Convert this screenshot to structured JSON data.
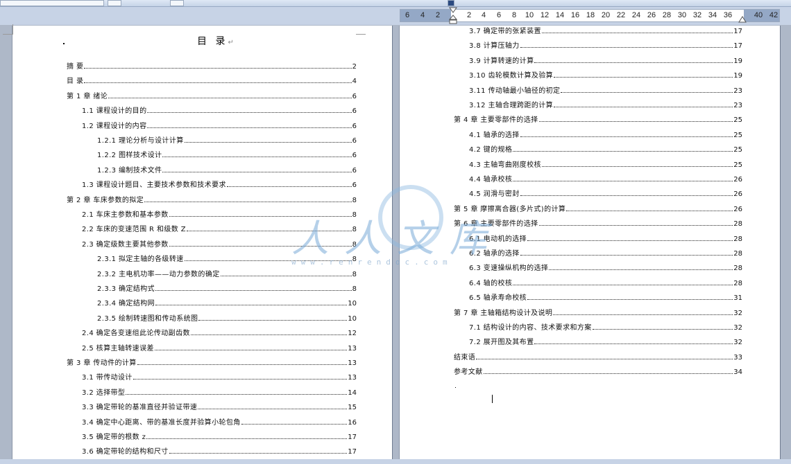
{
  "ruler": {
    "ticks": [
      "6",
      "4",
      "2",
      "2",
      "4",
      "6",
      "8",
      "10",
      "12",
      "14",
      "16",
      "18",
      "20",
      "22",
      "24",
      "26",
      "28",
      "30",
      "32",
      "34",
      "36",
      "40",
      "42"
    ]
  },
  "page_left": {
    "title": "目 录",
    "entries": [
      {
        "text": "摘  要",
        "page": "2"
      },
      {
        "text": "目  录",
        "page": "4"
      },
      {
        "text": "第 1 章  绪论",
        "page": "6"
      },
      {
        "text": "1.1  课程设计的目的",
        "page": "6"
      },
      {
        "text": "1.2 课程设计的内容",
        "page": "6"
      },
      {
        "text": "1.2.1  理论分析与设计计算",
        "page": "6"
      },
      {
        "text": "1.2.2  图样技术设计",
        "page": "6"
      },
      {
        "text": "1.2.3 编制技术文件",
        "page": "6"
      },
      {
        "text": "1.3  课程设计题目、主要技术参数和技术要求",
        "page": "6"
      },
      {
        "text": "第 2 章  车床参数的拟定",
        "page": "8"
      },
      {
        "text": "2.1 车床主参数和基本参数",
        "page": "8"
      },
      {
        "text": "2.2 车床的变速范围 R 和级数 Z",
        "page": "8"
      },
      {
        "text": "2.3 确定级数主要其他参数",
        "page": "8"
      },
      {
        "text": "2.3.1  拟定主轴的各级转速",
        "page": "8"
      },
      {
        "text": "2.3.2  主电机功率——动力参数的确定",
        "page": "8"
      },
      {
        "text": "2.3.3 确定结构式",
        "page": "8"
      },
      {
        "text": "2.3.4 确定结构网",
        "page": "10"
      },
      {
        "text": "2.3.5 绘制转速图和传动系统图",
        "page": "10"
      },
      {
        "text": "2.4  确定各变速组此论传动副齿数",
        "page": "12"
      },
      {
        "text": "2.5  核算主轴转速误差",
        "page": "13"
      },
      {
        "text": "第 3 章  传动件的计算",
        "page": "13"
      },
      {
        "text": "3.1  带传动设计",
        "page": "13"
      },
      {
        "text": "3.2 选择带型",
        "page": "14"
      },
      {
        "text": "3.3 确定带轮的基准直径并验证带速",
        "page": "15"
      },
      {
        "text": "3.4 确定中心距离、带的基准长度并验算小轮包角",
        "page": "16"
      },
      {
        "text": "3.5 确定带的根数 z",
        "page": "17"
      },
      {
        "text": "3.6 确定带轮的结构和尺寸",
        "page": "17"
      }
    ]
  },
  "page_right": {
    "entries": [
      {
        "text": "3.7 确定带的张紧装置",
        "page": "17"
      },
      {
        "text": "3.8 计算压轴力",
        "page": "17"
      },
      {
        "text": "3.9  计算转速的计算",
        "page": "19"
      },
      {
        "text": "3.10  齿轮模数计算及验算",
        "page": "19"
      },
      {
        "text": "3.11  传动轴最小轴径的初定",
        "page": "23"
      },
      {
        "text": "3.12  主轴合理跨距的计算",
        "page": "23"
      },
      {
        "text": "第 4 章  主要零部件的选择",
        "page": "25"
      },
      {
        "text": "4.1  轴承的选择",
        "page": "25"
      },
      {
        "text": "4.2  键的规格",
        "page": "25"
      },
      {
        "text": "4.3  主轴弯曲刚度校核",
        "page": "25"
      },
      {
        "text": "4.4 轴承校核",
        "page": "26"
      },
      {
        "text": "4.5  润滑与密封",
        "page": "26"
      },
      {
        "text": "第 5 章    摩擦离合器(多片式)的计算",
        "page": "26"
      },
      {
        "text": "第 6 章  主要零部件的选择",
        "page": "28"
      },
      {
        "text": "6.1  电动机的选择",
        "page": "28"
      },
      {
        "text": "6.2  轴承的选择",
        "page": "28"
      },
      {
        "text": "6.3 变速操纵机构的选择",
        "page": "28"
      },
      {
        "text": "6.4  轴的校核",
        "page": "28"
      },
      {
        "text": "6.5  轴承寿命校核",
        "page": "31"
      },
      {
        "text": "第 7 章  主轴箱结构设计及说明",
        "page": "32"
      },
      {
        "text": "7.1  结构设计的内容、技术要求和方案",
        "page": "32"
      },
      {
        "text": "7.2  展开图及其布置",
        "page": "32"
      },
      {
        "text": "结束语",
        "page": "33"
      },
      {
        "text": "参考文献",
        "page": "34"
      }
    ]
  },
  "watermark": {
    "text": "人人文库",
    "url": "www.renrendoc.com"
  }
}
